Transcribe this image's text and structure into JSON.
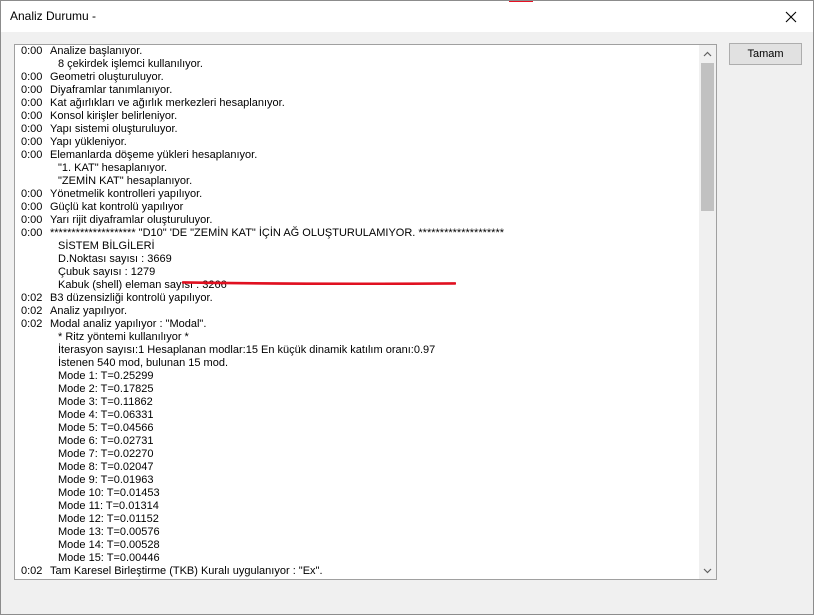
{
  "window": {
    "title": "Analiz Durumu -",
    "close_icon": "close-icon",
    "accent_color": "#e81123"
  },
  "ok_button": {
    "label": "Tamam"
  },
  "highlight_color": "#e01020",
  "log": [
    {
      "t": "0:00",
      "msg": "Analize başlanıyor.",
      "indent": 0
    },
    {
      "t": "",
      "msg": "8 çekirdek işlemci kullanılıyor.",
      "indent": 1
    },
    {
      "t": "0:00",
      "msg": "Geometri oluşturuluyor.",
      "indent": 0
    },
    {
      "t": "0:00",
      "msg": "Diyaframlar tanımlanıyor.",
      "indent": 0
    },
    {
      "t": "0:00",
      "msg": "Kat ağırlıkları ve ağırlık merkezleri hesaplanıyor.",
      "indent": 0
    },
    {
      "t": "0:00",
      "msg": "Konsol kirişler belirleniyor.",
      "indent": 0
    },
    {
      "t": "0:00",
      "msg": "Yapı sistemi oluşturuluyor.",
      "indent": 0
    },
    {
      "t": "0:00",
      "msg": "Yapı yükleniyor.",
      "indent": 0
    },
    {
      "t": "0:00",
      "msg": "Elemanlarda döşeme yükleri hesaplanıyor.",
      "indent": 0
    },
    {
      "t": "",
      "msg": "\"1. KAT\" hesaplanıyor.",
      "indent": 1
    },
    {
      "t": "",
      "msg": "\"ZEMİN KAT\" hesaplanıyor.",
      "indent": 1
    },
    {
      "t": "0:00",
      "msg": "Yönetmelik kontrolleri yapılıyor.",
      "indent": 0
    },
    {
      "t": "0:00",
      "msg": "Güçlü kat kontrolü yapılıyor",
      "indent": 0
    },
    {
      "t": "0:00",
      "msg": "Yarı rijit diyaframlar oluşturuluyor.",
      "indent": 0
    },
    {
      "t": "0:00",
      "msg": "******************** \"D10\" 'DE \"ZEMİN KAT\" İÇİN AĞ OLUŞTURULAMIYOR. ********************",
      "indent": 0
    },
    {
      "t": "",
      "msg": "SİSTEM BİLGİLERİ",
      "indent": 1
    },
    {
      "t": "",
      "msg": "D.Noktası sayısı : 3669",
      "indent": 1
    },
    {
      "t": "",
      "msg": "Çubuk sayısı : 1279",
      "indent": 1
    },
    {
      "t": "",
      "msg": "Kabuk (shell) eleman sayısı : 3266",
      "indent": 1
    },
    {
      "t": "0:02",
      "msg": "B3 düzensizliği kontrolü yapılıyor.",
      "indent": 0
    },
    {
      "t": "0:02",
      "msg": "Analiz yapılıyor.",
      "indent": 0
    },
    {
      "t": "0:02",
      "msg": "Modal analiz yapılıyor : \"Modal\".",
      "indent": 0
    },
    {
      "t": "",
      "msg": "* Ritz yöntemi kullanılıyor *",
      "indent": 1
    },
    {
      "t": "",
      "msg": "İterasyon sayısı:1      Hesaplanan modlar:15          En küçük dinamik katılım oranı:0.97",
      "indent": 1
    },
    {
      "t": "",
      "msg": "İstenen 540 mod, bulunan 15 mod.",
      "indent": 1
    },
    {
      "t": "",
      "msg": "Mode 1:      T=0.25299",
      "indent": 1
    },
    {
      "t": "",
      "msg": "Mode 2:      T=0.17825",
      "indent": 1
    },
    {
      "t": "",
      "msg": "Mode 3:      T=0.11862",
      "indent": 1
    },
    {
      "t": "",
      "msg": "Mode 4:      T=0.06331",
      "indent": 1
    },
    {
      "t": "",
      "msg": "Mode 5:      T=0.04566",
      "indent": 1
    },
    {
      "t": "",
      "msg": "Mode 6:      T=0.02731",
      "indent": 1
    },
    {
      "t": "",
      "msg": "Mode 7:      T=0.02270",
      "indent": 1
    },
    {
      "t": "",
      "msg": "Mode 8:      T=0.02047",
      "indent": 1
    },
    {
      "t": "",
      "msg": "Mode 9:      T=0.01963",
      "indent": 1
    },
    {
      "t": "",
      "msg": "Mode 10:    T=0.01453",
      "indent": 1
    },
    {
      "t": "",
      "msg": "Mode 11:    T=0.01314",
      "indent": 1
    },
    {
      "t": "",
      "msg": "Mode 12:    T=0.01152",
      "indent": 1
    },
    {
      "t": "",
      "msg": "Mode 13:    T=0.00576",
      "indent": 1
    },
    {
      "t": "",
      "msg": "Mode 14:    T=0.00528",
      "indent": 1
    },
    {
      "t": "",
      "msg": "Mode 15:    T=0.00446",
      "indent": 1
    },
    {
      "t": "0:02",
      "msg": "Tam Karesel Birleştirme (TKB) Kuralı uygulanıyor : \"Ex\".",
      "indent": 0
    }
  ],
  "scrollbar": {
    "up_icon": "chevron-up-icon",
    "down_icon": "chevron-down-icon"
  }
}
